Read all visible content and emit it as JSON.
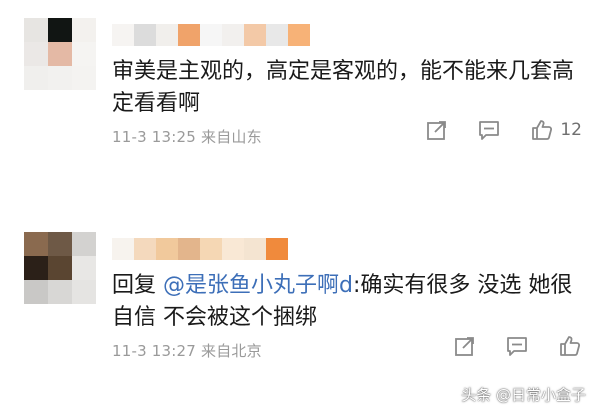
{
  "comments": [
    {
      "text": "审美是主观的，高定是客观的，能不能来几套高定看看啊",
      "timestamp": "11-3 13:25",
      "location": "来自山东",
      "like_count": "12",
      "avatar_colors": [
        "#e7e5e2",
        "#111513",
        "#f3f1ee",
        "#ebe8e6",
        "#e4b9a5",
        "#f5f4f2",
        "#f0efed",
        "#f2f1ef",
        "#f4f3f1"
      ],
      "nick_colors": [
        "#f6f4f2",
        "#dcdcdc",
        "#f1efec",
        "#f0a36a",
        "#f6f6f6",
        "#f2f0ee",
        "#f3c9a7",
        "#e8e8e8",
        "#f7b277"
      ]
    },
    {
      "reply_prefix": "回复",
      "mention": "@是张鱼小丸子啊d",
      "reply_text": ":确实有很多 没选 她很自信 不会被这个捆绑",
      "timestamp": "11-3 13:27",
      "location": "来自北京",
      "avatar_colors": [
        "#8a6a4f",
        "#6e5946",
        "#d3d2d0",
        "#2b2018",
        "#5a4531",
        "#e8e7e5",
        "#c9c8c6",
        "#d8d7d5",
        "#e5e4e2"
      ],
      "nick_colors": [
        "#f7f3ee",
        "#f4d9bd",
        "#f1c99c",
        "#e3b58c",
        "#f5d7b4",
        "#f9e8d5",
        "#f4e4d1",
        "#f08a3c"
      ]
    }
  ],
  "icons": {
    "share": "share-icon",
    "comment": "comment-icon",
    "like": "thumbs-up-icon"
  },
  "watermark": "头条 @日常小盒子"
}
